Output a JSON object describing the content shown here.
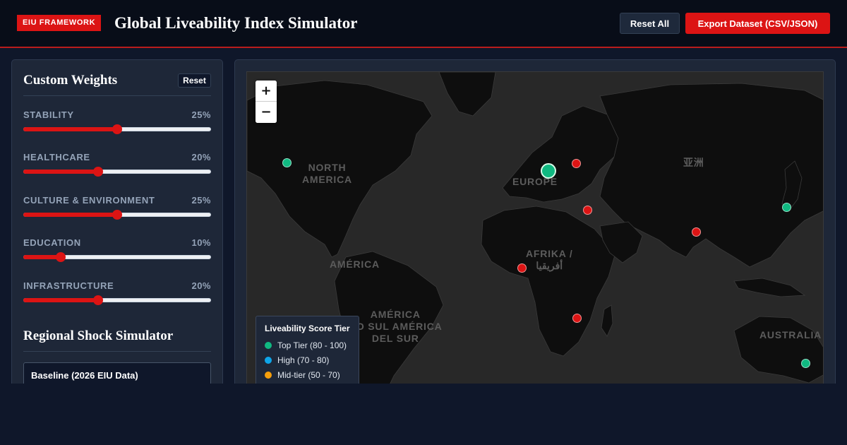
{
  "header": {
    "badge": "EIU FRAMEWORK",
    "title": "Global Liveability Index Simulator",
    "reset_all_label": "Reset All",
    "export_label": "Export Dataset (CSV/JSON)"
  },
  "weights": {
    "title": "Custom Weights",
    "reset_label": "Reset",
    "items": [
      {
        "label": "STABILITY",
        "value": "25%",
        "slider_fraction": 0.5
      },
      {
        "label": "HEALTHCARE",
        "value": "20%",
        "slider_fraction": 0.4
      },
      {
        "label": "CULTURE & ENVIRONMENT",
        "value": "25%",
        "slider_fraction": 0.5
      },
      {
        "label": "EDUCATION",
        "value": "10%",
        "slider_fraction": 0.2
      },
      {
        "label": "INFRASTRUCTURE",
        "value": "20%",
        "slider_fraction": 0.4
      }
    ]
  },
  "shock": {
    "title": "Regional Shock Simulator",
    "scenario": "Baseline (2026 EIU Data)"
  },
  "map": {
    "zoom_in": "+",
    "zoom_out": "−",
    "labels": {
      "north_america": "NORTH\nAMERICA",
      "europe": "EUROPE",
      "asia": "亚洲",
      "america": "AMÉRICA",
      "africa": "AFRIKA /\nأفريقيا",
      "south_america": "AMÉRICA\nDO SUL AMÉRICA\nDEL SUR",
      "australia": "AUSTRALIA"
    },
    "legend": {
      "title": "Liveability Score Tier",
      "items": [
        {
          "label": "Top Tier (80 - 100)",
          "color": "#10b981"
        },
        {
          "label": "High (70 - 80)",
          "color": "#0ea5e9"
        },
        {
          "label": "Mid-tier (50 - 70)",
          "color": "#f59e0b"
        }
      ]
    }
  },
  "colors": {
    "accent": "#dc1414",
    "top_tier": "#10b981",
    "low_tier": "#dc1414"
  }
}
